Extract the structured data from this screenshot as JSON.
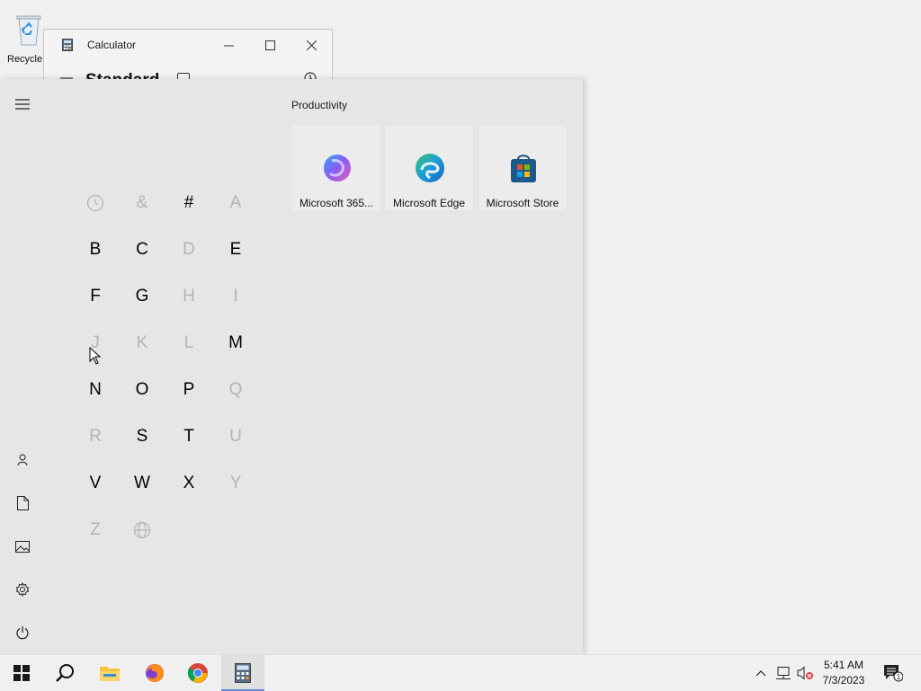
{
  "desktop": {
    "recycle_bin_label": "Recycle Bin"
  },
  "calculator": {
    "title": "Calculator",
    "mode": "Standard"
  },
  "start_menu": {
    "rail": [
      "menu-icon",
      "user-icon",
      "documents-icon",
      "pictures-icon",
      "settings-icon",
      "power-icon"
    ],
    "letter_grid": [
      {
        "label": "clock",
        "enabled": false,
        "icon": "recent-clock-icon"
      },
      {
        "label": "&",
        "enabled": false
      },
      {
        "label": "#",
        "enabled": true
      },
      {
        "label": "A",
        "enabled": false
      },
      {
        "label": "B",
        "enabled": true
      },
      {
        "label": "C",
        "enabled": true
      },
      {
        "label": "D",
        "enabled": false
      },
      {
        "label": "E",
        "enabled": true
      },
      {
        "label": "F",
        "enabled": true
      },
      {
        "label": "G",
        "enabled": true
      },
      {
        "label": "H",
        "enabled": false
      },
      {
        "label": "I",
        "enabled": false
      },
      {
        "label": "J",
        "enabled": false
      },
      {
        "label": "K",
        "enabled": false
      },
      {
        "label": "L",
        "enabled": false
      },
      {
        "label": "M",
        "enabled": true
      },
      {
        "label": "N",
        "enabled": true
      },
      {
        "label": "O",
        "enabled": true
      },
      {
        "label": "P",
        "enabled": true
      },
      {
        "label": "Q",
        "enabled": false
      },
      {
        "label": "R",
        "enabled": false
      },
      {
        "label": "S",
        "enabled": true
      },
      {
        "label": "T",
        "enabled": true
      },
      {
        "label": "U",
        "enabled": false
      },
      {
        "label": "V",
        "enabled": true
      },
      {
        "label": "W",
        "enabled": true
      },
      {
        "label": "X",
        "enabled": true
      },
      {
        "label": "Y",
        "enabled": false
      },
      {
        "label": "Z",
        "enabled": false
      },
      {
        "label": "globe",
        "enabled": false,
        "icon": "globe-icon"
      }
    ],
    "group": {
      "title": "Productivity",
      "tiles": [
        {
          "label": "Microsoft 365...",
          "icon": "microsoft-365-icon"
        },
        {
          "label": "Microsoft Edge",
          "icon": "edge-icon"
        },
        {
          "label": "Microsoft Store",
          "icon": "store-icon"
        }
      ]
    }
  },
  "taskbar": {
    "apps": [
      "windows-start-icon",
      "search-icon",
      "file-explorer-icon",
      "firefox-icon",
      "chrome-icon",
      "calculator-icon"
    ],
    "active_app": "calculator-icon",
    "clock_time": "5:41 AM",
    "clock_date": "7/3/2023",
    "notification_count": "1"
  },
  "colors": {
    "start_bg": "#e6e6e6",
    "taskbar_bg": "#f0f0f0",
    "active_indicator": "#6b8fd6",
    "disabled_text": "#b3b3b3"
  }
}
